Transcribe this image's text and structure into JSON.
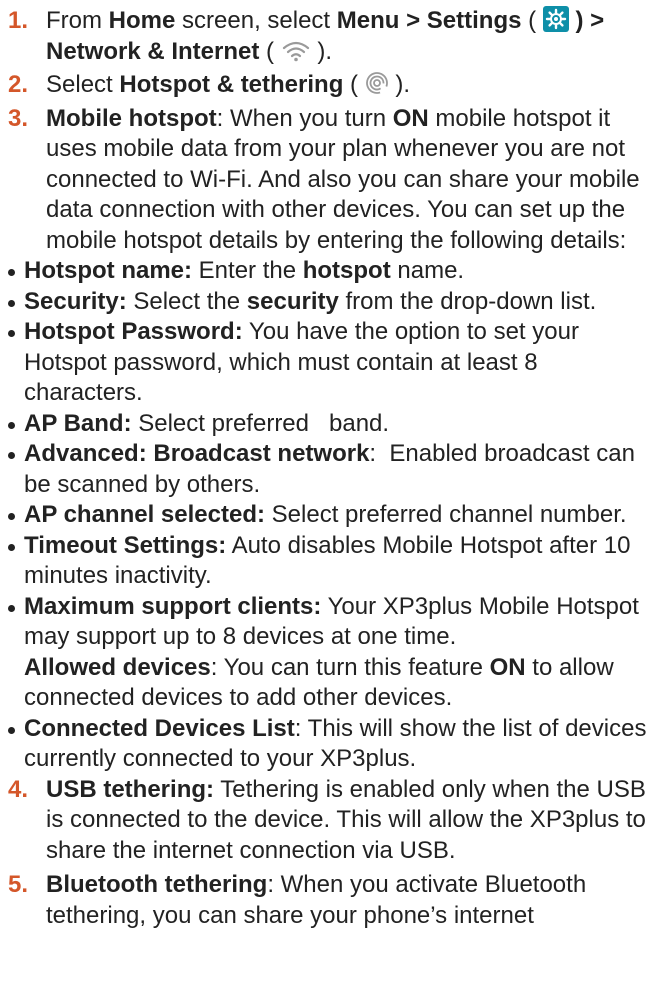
{
  "steps": [
    {
      "num": "1.",
      "a": "From ",
      "b_home": "Home",
      "c": " screen, select ",
      "b_menu": "Menu > Settings",
      "d": " ( ",
      "e": " ) >",
      "b_network": "Network & Internet",
      "f": " ( ",
      "g": " )."
    },
    {
      "num": "2.",
      "a": "Select ",
      "b": "Hotspot & tethering",
      "c": " ( ",
      "d": " )."
    },
    {
      "num": "3.",
      "b": "Mobile hotspot",
      "a": ": When you turn ",
      "b_on": "ON",
      "c": " mobile hotspot it uses mobile data from your plan whenever you are not connected to Wi-Fi. And also you can share your mobile data connection with other devices. You can set up the mobile hotspot details by entering the following details:",
      "bullets": [
        {
          "label": "Hotspot name:",
          "t1": " Enter the ",
          "em": "hotspot",
          "t2": " name."
        },
        {
          "label": "Security:",
          "t1": " Select the ",
          "em": "security",
          "t2": " from the drop-down list."
        },
        {
          "label": "Hotspot Password:",
          "t1": " You have the option to set your Hotspot password, which must contain at least 8 characters."
        },
        {
          "label": "AP Band:",
          "t1": " Select preferred   band."
        },
        {
          "label": "Advanced: Broadcast network",
          "t1": ":  Enabled broadcast can be scanned by others."
        },
        {
          "label": "AP channel selected:",
          "t1": " Select preferred channel number."
        },
        {
          "label": "Timeout Settings:",
          "t1": " Auto disables Mobile Hotspot after 10 minutes inactivity."
        },
        {
          "label": "Maximum support clients:",
          "t1": " Your XP3plus Mobile Hotspot may support up to 8 devices at one time.",
          "label2": "Allowed devices",
          "t2": ": You can turn this feature ",
          "em2": "ON",
          "t3": " to allow connected devices to add other devices."
        },
        {
          "label": "Connected Devices List",
          "t1": ": This will show the list of devices currently connected to your XP3plus."
        }
      ]
    },
    {
      "num": "4.",
      "b": "USB tethering:",
      "a": " Tethering is enabled only when the USB is connected to the device. This will allow the XP3plus to share the internet connection via USB."
    },
    {
      "num": "5.",
      "b": "Bluetooth tethering",
      "a": ": When you activate Bluetooth tethering, you can share your phone’s internet"
    }
  ],
  "colors": {
    "number": "#d4572a",
    "settings_icon_bg": "#0e8fa8",
    "text": "#222222"
  },
  "icons": {
    "settings": "gear-icon",
    "network": "wifi-icon",
    "hotspot": "hotspot-icon"
  }
}
